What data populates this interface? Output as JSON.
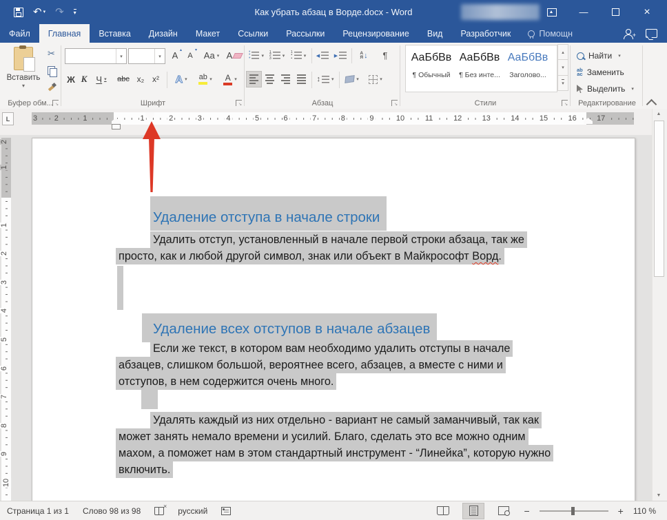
{
  "window": {
    "title": "Как убрать абзац в Ворде.docx - Word"
  },
  "tabs": [
    "Файл",
    "Главная",
    "Вставка",
    "Дизайн",
    "Макет",
    "Ссылки",
    "Рассылки",
    "Рецензирование",
    "Вид",
    "Разработчик"
  ],
  "assistant": {
    "label": "Помощн"
  },
  "ribbon": {
    "clipboard": {
      "paste": "Вставить",
      "group_label": "Буфер обм..."
    },
    "font": {
      "group_label": "Шрифт",
      "font_name_value": "",
      "font_size_value": "",
      "bold": "Ж",
      "italic": "К",
      "underline": "Ч",
      "strikethrough": "abc",
      "subscript": "x₂",
      "superscript": "x²",
      "grow": "А",
      "shrink": "А",
      "change_case": "Аа",
      "clear_format": "А",
      "text_effects": "А",
      "highlight": "ab",
      "font_color": "А"
    },
    "paragraph": {
      "group_label": "Абзац",
      "sort_letters": "А\nЯ",
      "pilcrow": "¶",
      "bullet_col": "•\n•\n•",
      "number_col": "1\n2\n3",
      "multi_col": "1\n•\n•",
      "outdent_arrow": "◀",
      "indent_arrow": "▶",
      "sort_arrow": "↓",
      "spacing_arrows": "↕"
    },
    "styles": {
      "group_label": "Стили",
      "items": [
        {
          "preview": "АаБбВв",
          "name": "¶ Обычный"
        },
        {
          "preview": "АаБбВв",
          "name": "¶ Без инте..."
        },
        {
          "preview": "АаБбВв",
          "name": "Заголово..."
        }
      ]
    },
    "editing": {
      "group_label": "Редактирование",
      "find": "Найти",
      "replace": "Заменить",
      "select": "Выделить",
      "replace_icon": "ab\nac"
    }
  },
  "icons": {
    "save": "floppy",
    "undo": "↶",
    "redo": "↷",
    "scissors": "✂",
    "min": "—",
    "close": "×"
  },
  "ruler": {
    "margin_numbers_h": [
      "1",
      "2",
      "3"
    ],
    "numbers_h": [
      "1",
      "2",
      "3",
      "4",
      "5",
      "6",
      "7",
      "8",
      "9",
      "10",
      "11",
      "12",
      "13",
      "14",
      "15",
      "16"
    ],
    "right_number_h": "17",
    "margin_numbers_v": [
      "1",
      "2"
    ],
    "numbers_v": [
      "1",
      "2",
      "3",
      "4",
      "5",
      "6",
      "7",
      "8",
      "9",
      "10"
    ]
  },
  "document": {
    "heading1": "Удаление отступа в начале строки",
    "para1_line1": "Удалить отступ, установленный в начале первой строки абзаца, так же",
    "para1_line2_pre": "просто, как и любой другой символ, знак или объект в Майкрософт ",
    "para1_misspelled": "Ворд",
    "para1_line2_post": ".",
    "heading2": "Удаление всех отступов в начале абзацев",
    "para2_line1": "Если же текст, в котором вам необходимо удалить отступы в начале",
    "para2_line2": "абзацев, слишком большой, вероятнее всего, абзацев, а вместе с ними и",
    "para2_line3": "отступов, в нем содержится очень много.",
    "para3_line1": "Удалять каждый из них отдельно - вариант не самый заманчивый, так как",
    "para3_line2": "может занять немало времени и усилий. Благо, сделать это все можно одним",
    "para3_line3": "махом, а поможет нам в этом стандартный инструмент - “Линейка”, которую нужно",
    "para3_line4": "включить."
  },
  "statusbar": {
    "page": "Страница 1 из 1",
    "words": "Слово 98 из 98",
    "language": "русский",
    "zoom": "110 %"
  },
  "colors": {
    "titlebar": "#2b579a",
    "heading": "#2e74b5",
    "selection": "#c9c9c9",
    "annotation_arrow": "#dd3826"
  }
}
